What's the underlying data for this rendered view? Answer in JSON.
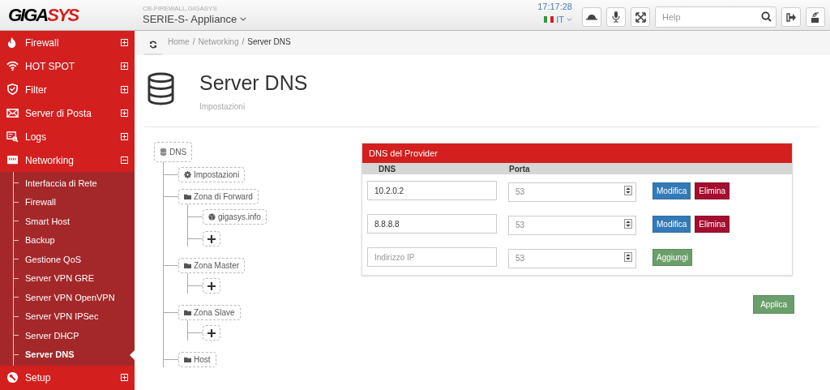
{
  "header": {
    "logo_parts": [
      "GIGA",
      "SYS"
    ],
    "hostname": "CB-FIREWALL.GIGASYS",
    "product": "SERIE-S- Appliance",
    "clock": "17:17:28",
    "language": "IT",
    "search": {
      "placeholder": "Help"
    }
  },
  "sidebar": {
    "items": [
      {
        "label": "Firewall",
        "expanded": false
      },
      {
        "label": "HOT SPOT",
        "expanded": false
      },
      {
        "label": "Filter",
        "expanded": false
      },
      {
        "label": "Server di Posta",
        "expanded": false
      },
      {
        "label": "Logs",
        "expanded": false
      },
      {
        "label": "Networking",
        "expanded": true,
        "children": [
          {
            "label": "Interfaccia di Rete",
            "selected": false
          },
          {
            "label": "Firewall",
            "selected": false
          },
          {
            "label": "Smart Host",
            "selected": false
          },
          {
            "label": "Backup",
            "selected": false
          },
          {
            "label": "Gestione QoS",
            "selected": false
          },
          {
            "label": "Server VPN GRE",
            "selected": false
          },
          {
            "label": "Server VPN OpenVPN",
            "selected": false
          },
          {
            "label": "Server VPN IPSec",
            "selected": false
          },
          {
            "label": "Server DHCP",
            "selected": false
          },
          {
            "label": "Server DNS",
            "selected": true
          }
        ]
      },
      {
        "label": "Setup",
        "expanded": false
      }
    ]
  },
  "breadcrumb": [
    {
      "label": "Home",
      "separator": "/"
    },
    {
      "label": "Networking",
      "separator": "/"
    },
    {
      "label": "Server DNS"
    }
  ],
  "page": {
    "title": "Server DNS",
    "subtitle": "Impostazioni"
  },
  "tree": {
    "kind": "root",
    "label": "DNS",
    "children": [
      {
        "kind": "settings",
        "label": "Impostazioni"
      },
      {
        "kind": "folder",
        "label": "Zona di Forward",
        "children": [
          {
            "kind": "domain",
            "label": "gigasys.info"
          },
          {
            "kind": "add"
          }
        ]
      },
      {
        "kind": "folder",
        "label": "Zona Master",
        "children": [
          {
            "kind": "add"
          }
        ]
      },
      {
        "kind": "folder",
        "label": "Zona Slave",
        "children": [
          {
            "kind": "add"
          }
        ]
      },
      {
        "kind": "folder",
        "label": "Host"
      }
    ]
  },
  "panel": {
    "title": "DNS del Provider",
    "columns": [
      "DNS",
      "Porta"
    ],
    "rows": [
      {
        "dns": {
          "value": "10.2.0.2"
        },
        "port": {
          "placeholder": "53"
        },
        "actions": [
          {
            "kind": "edit",
            "label": "Modifica"
          },
          {
            "kind": "delete",
            "label": "Elimina"
          }
        ]
      },
      {
        "dns": {
          "value": "8.8.8.8"
        },
        "port": {
          "placeholder": "53"
        },
        "actions": [
          {
            "kind": "edit",
            "label": "Modifica"
          },
          {
            "kind": "delete",
            "label": "Elimina"
          }
        ]
      },
      {
        "dns": {
          "placeholder": "Indirizzo IP"
        },
        "port": {
          "placeholder": "53"
        },
        "actions": [
          {
            "kind": "add",
            "label": "Aggiungi"
          }
        ]
      }
    ]
  },
  "apply_button": "Applica"
}
